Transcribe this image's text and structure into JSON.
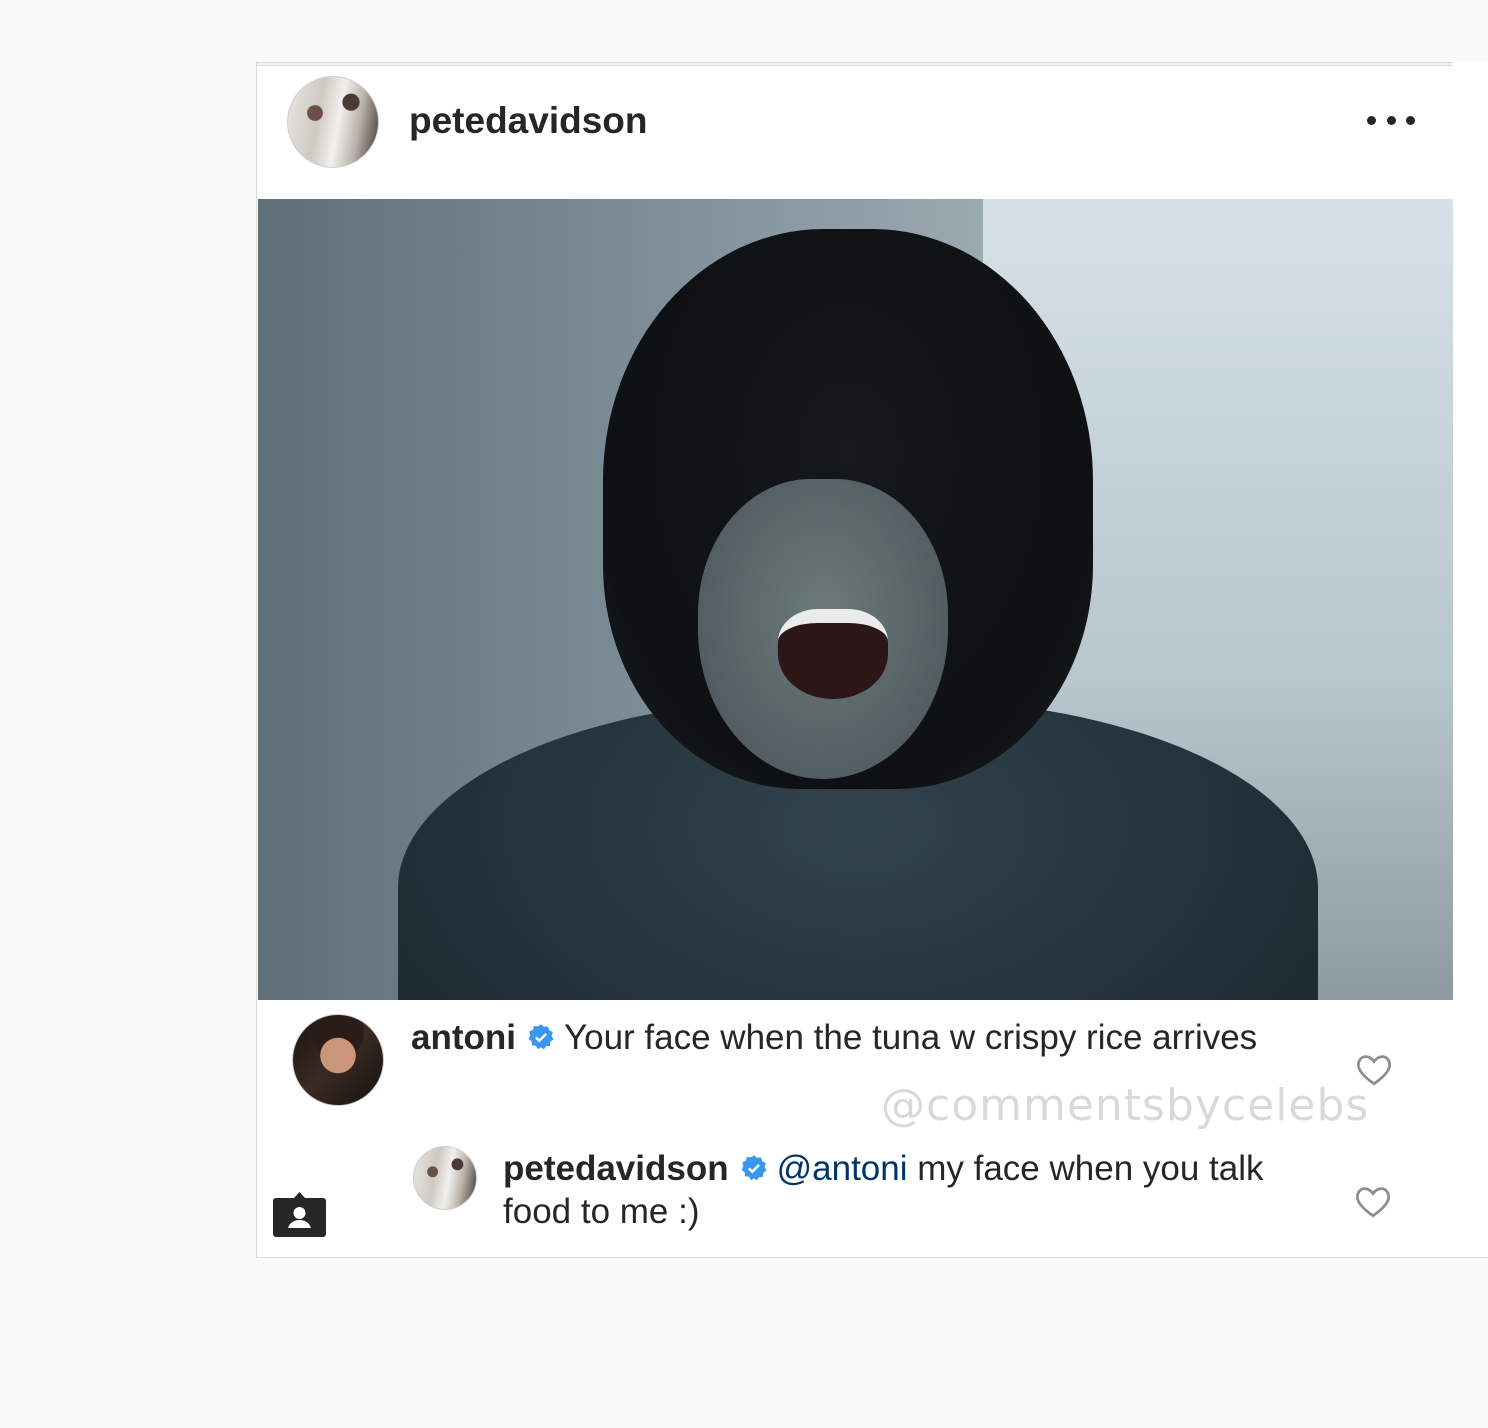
{
  "post": {
    "username": "petedavidson"
  },
  "comments": [
    {
      "username": "antoni",
      "verified": true,
      "text": "Your face when the tuna w crispy rice arrives"
    },
    {
      "username": "petedavidson",
      "verified": true,
      "mention": "@antoni",
      "text": " my face when you talk food to me :)"
    }
  ],
  "watermark": "@commentsbycelebs",
  "icons": {
    "more": "more-options-icon",
    "verified": "verified-badge-icon",
    "like": "heart-icon",
    "user_tag": "user-tag-icon"
  },
  "colors": {
    "verified": "#3897f0",
    "mention": "#003569",
    "text": "#262626"
  }
}
